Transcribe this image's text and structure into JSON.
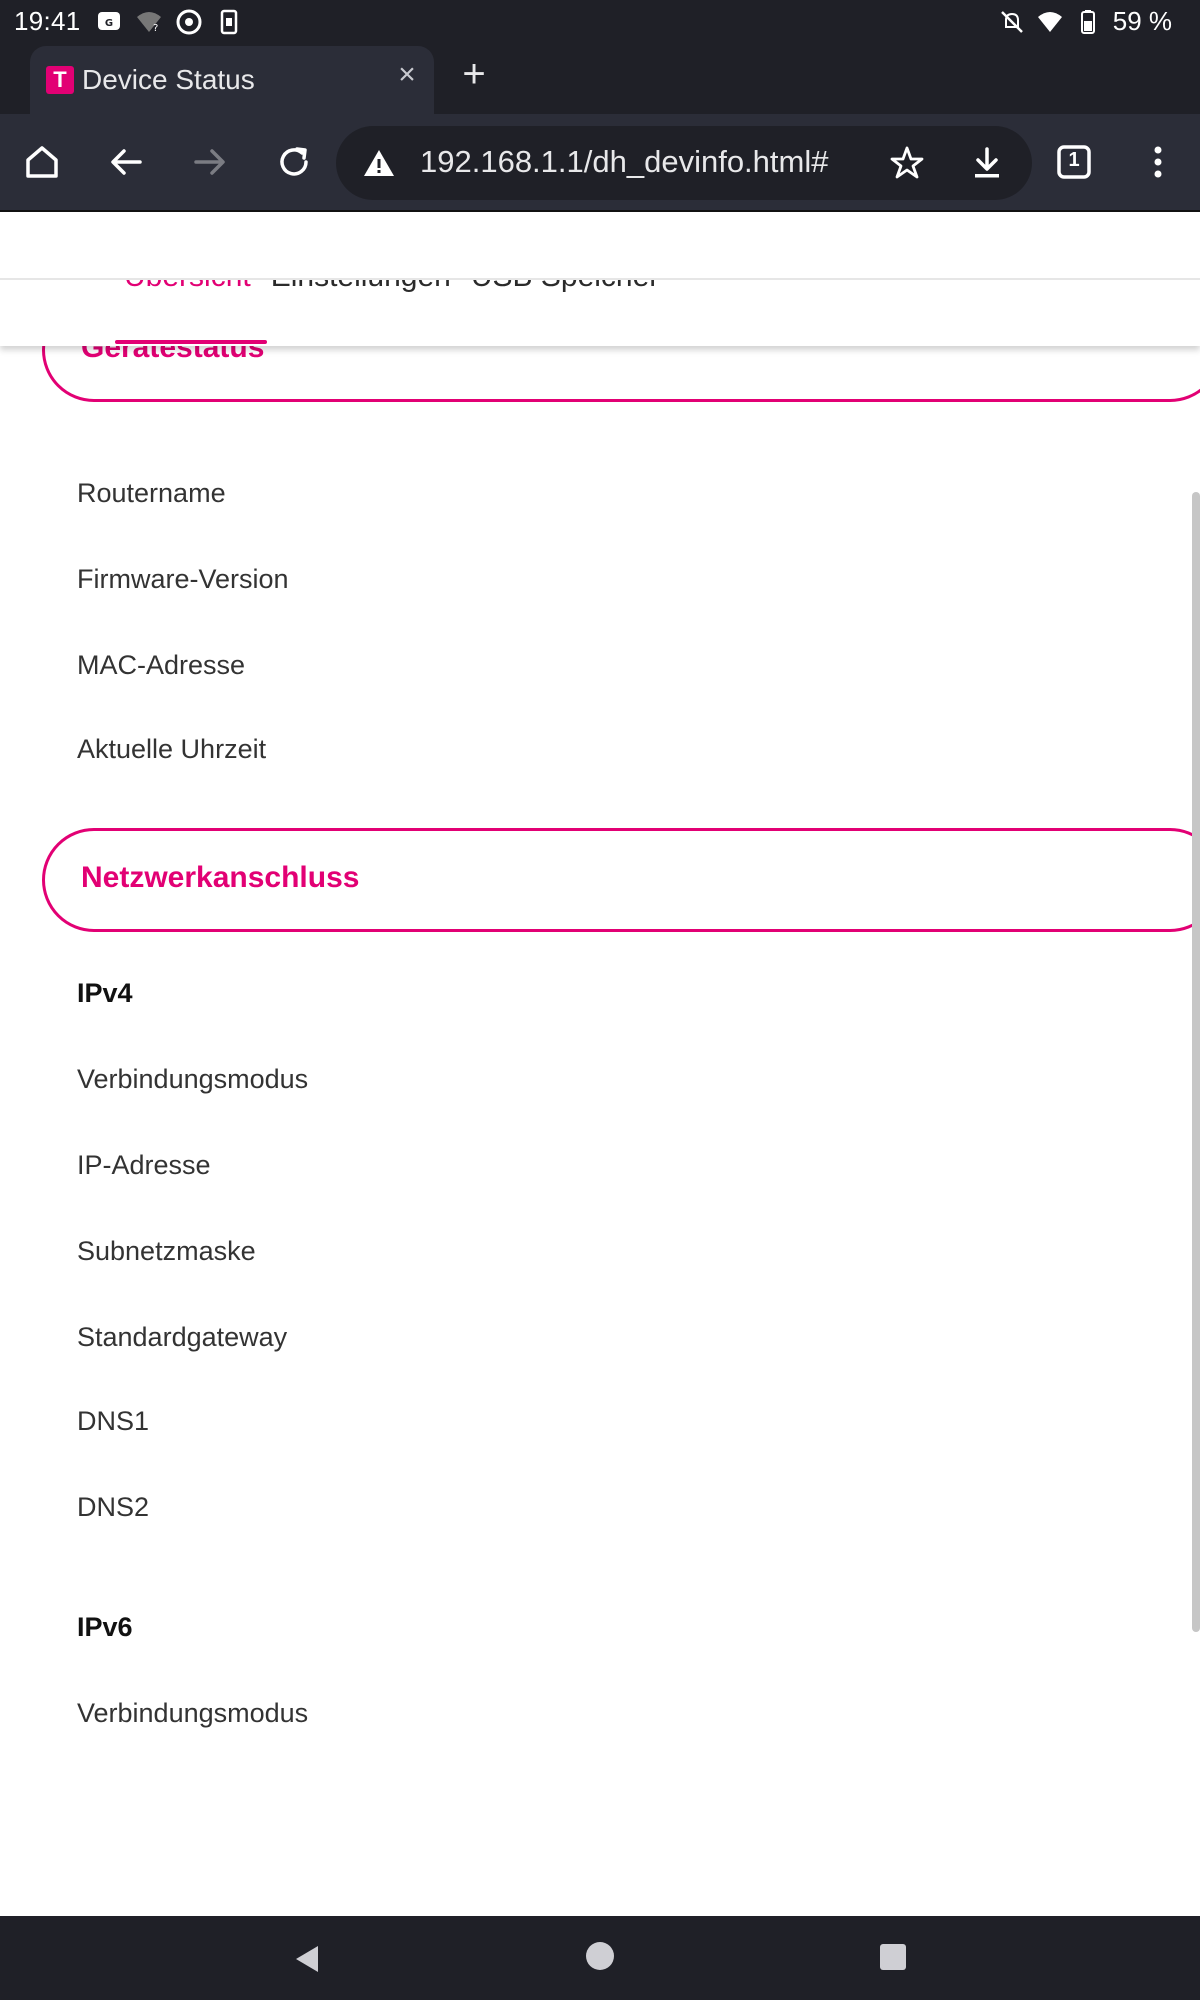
{
  "status_bar": {
    "time": "19:41",
    "battery": "59 %"
  },
  "browser": {
    "tab_title": "Device Status",
    "tab_close": "×",
    "new_tab": "+",
    "url": "192.168.1.1/dh_devinfo.html#",
    "tab_count": "1"
  },
  "nav": {
    "tabs": [
      "Übersicht",
      "Einstellungen",
      "USB Speicher"
    ]
  },
  "sections": {
    "device_status": {
      "title": "Gerätestatus",
      "rows": [
        "Routername",
        "Firmware-Version",
        "MAC-Adresse",
        "Aktuelle Uhrzeit"
      ]
    },
    "network": {
      "title": "Netzwerkanschluss",
      "ipv4_heading": "IPv4",
      "ipv4_rows": [
        "Verbindungsmodus",
        "IP-Adresse",
        "Subnetzmaske",
        "Standardgateway",
        "DNS1",
        "DNS2"
      ],
      "ipv6_heading": "IPv6",
      "ipv6_rows": [
        "Verbindungsmodus"
      ]
    }
  },
  "colors": {
    "brand": "#e20074",
    "chrome_dark": "#1f2027",
    "toolbar": "#2b2d38"
  }
}
